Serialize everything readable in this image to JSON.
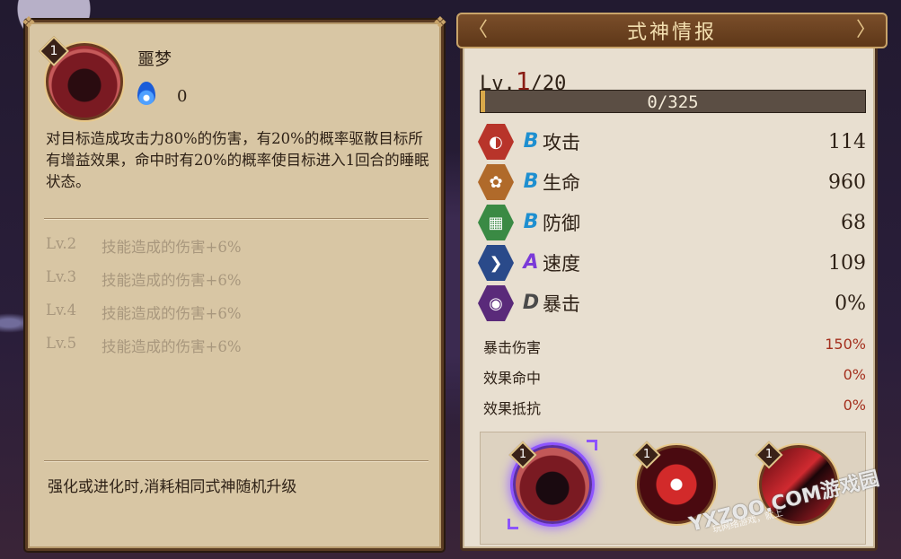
{
  "skill_panel": {
    "level_badge": "1",
    "name": "噩梦",
    "cost": "0",
    "cost_icon": "blue-spirit-fire-icon",
    "description": "对目标造成攻击力80%的伤害，有20%的概率驱散目标所有增益效果，命中时有20%的概率使目标进入1回合的睡眠状态。",
    "levels": [
      {
        "lv": "Lv.2",
        "text": "技能造成的伤害+6%"
      },
      {
        "lv": "Lv.3",
        "text": "技能造成的伤害+6%"
      },
      {
        "lv": "Lv.4",
        "text": "技能造成的伤害+6%"
      },
      {
        "lv": "Lv.5",
        "text": "技能造成的伤害+6%"
      }
    ],
    "footer_note": "强化或进化时,消耗相同式神随机升级"
  },
  "info_panel": {
    "title": "式神情报",
    "lv_prefix": "Lv.",
    "lv_current": "1",
    "lv_max": "/20",
    "exp_text": "0/325",
    "exp_fraction": 0.0,
    "stats": [
      {
        "icon": "fan-icon",
        "grade": "B",
        "grade_color": "#1e8fd0",
        "name": "攻击",
        "value": "114",
        "icon_color": "#b8342a"
      },
      {
        "icon": "scroll-icon",
        "grade": "B",
        "grade_color": "#1e8fd0",
        "name": "生命",
        "value": "960",
        "icon_color": "#b06a2a"
      },
      {
        "icon": "armor-icon",
        "grade": "B",
        "grade_color": "#1e8fd0",
        "name": "防御",
        "value": "68",
        "icon_color": "#3a8a44"
      },
      {
        "icon": "arrow-icon",
        "grade": "A",
        "grade_color": "#7a3ad8",
        "name": "速度",
        "value": "109",
        "icon_color": "#2a4a8a"
      },
      {
        "icon": "eye-icon",
        "grade": "D",
        "grade_color": "#4a4a4a",
        "name": "暴击",
        "value": "0%",
        "icon_color": "#5a2a7a"
      }
    ],
    "sub_stats": [
      {
        "name": "暴击伤害",
        "value": "150%"
      },
      {
        "name": "效果命中",
        "value": "0%"
      },
      {
        "name": "效果抵抗",
        "value": "0%"
      }
    ],
    "skills": [
      {
        "badge": "1",
        "selected": true
      },
      {
        "badge": "1",
        "selected": false
      },
      {
        "badge": "1",
        "selected": false
      }
    ]
  },
  "watermark": {
    "text": "YXZOO.COM游戏园",
    "sub": "玩网络游戏，就上"
  }
}
